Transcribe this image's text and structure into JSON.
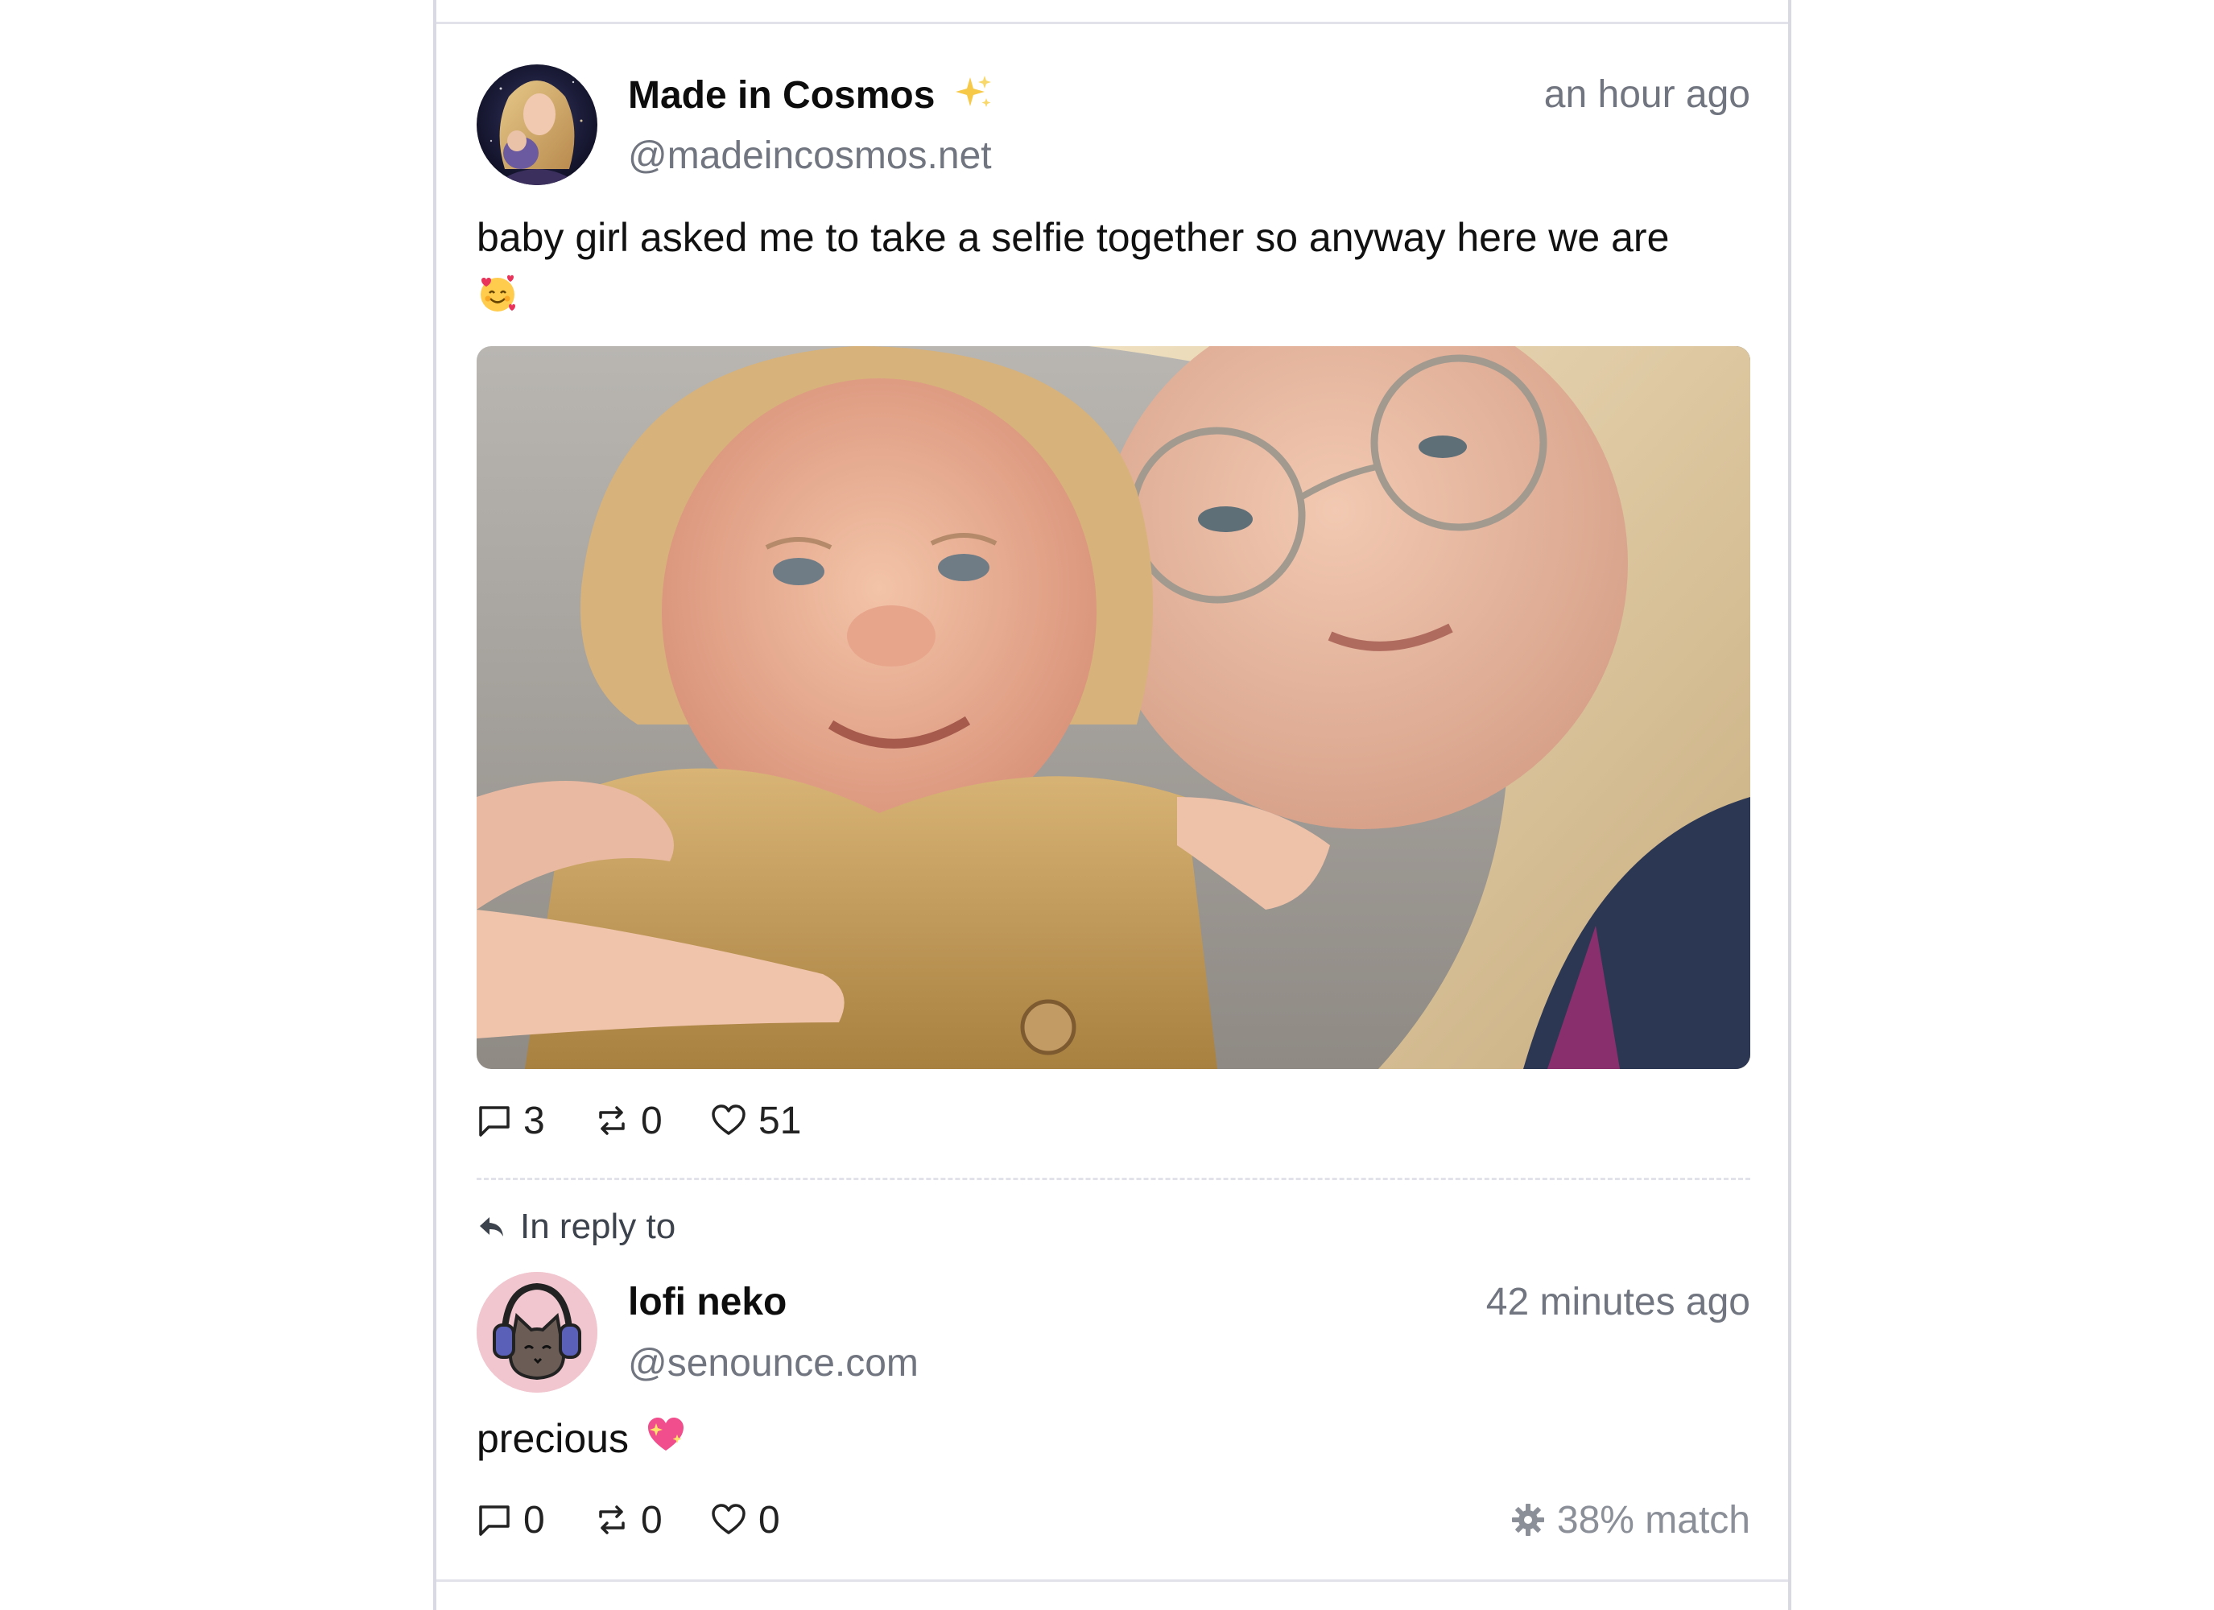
{
  "post": {
    "author_name": "Made in Cosmos",
    "author_handle": "@madeincosmos.net",
    "timestamp": "an hour ago",
    "text": "baby girl asked me to take a selfie together so anyway here we are",
    "name_emoji_icon": "sparkles-icon",
    "text_emoji_icon": "smiling-face-with-hearts-icon",
    "counts": {
      "replies": "3",
      "reposts": "0",
      "likes": "51"
    }
  },
  "reply": {
    "label": "In reply to",
    "author_name": "lofi neko",
    "author_handle": "@senounce.com",
    "timestamp": "42 minutes ago",
    "text": "precious",
    "text_emoji_icon": "sparkling-heart-icon",
    "counts": {
      "replies": "0",
      "reposts": "0",
      "likes": "0"
    },
    "match_label": "38% match"
  },
  "colors": {
    "muted_text": "#70757f",
    "border": "#d9d9e3",
    "divider": "#e2e2ea",
    "reply_avatar_bg": "#f1c6cf"
  }
}
